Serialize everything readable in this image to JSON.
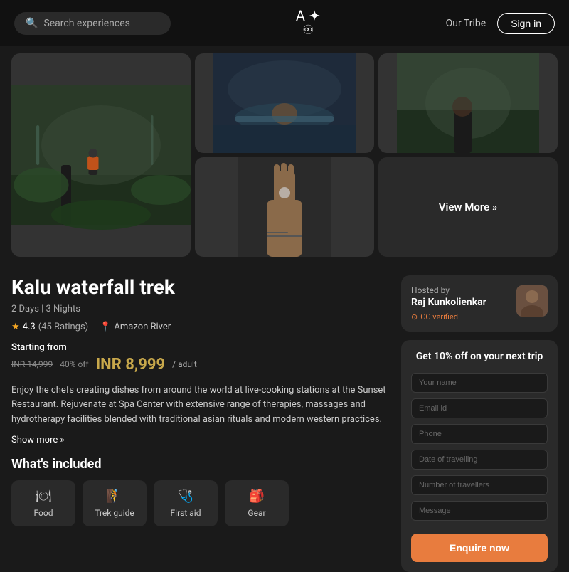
{
  "header": {
    "search_placeholder": "Search experiences",
    "logo_top": "A ✦",
    "logo_bottom": "♾",
    "our_tribe": "Our Tribe",
    "sign_in": "Sign in"
  },
  "gallery": {
    "view_more": "View More »"
  },
  "trip": {
    "title": "Kalu waterfall trek",
    "duration": "2 Days | 3 Nights",
    "rating": "4.3",
    "rating_count": "(45 Ratings)",
    "location": "Amazon River",
    "starting_from_label": "Starting from",
    "original_price": "INR 14,999",
    "discount": "40% off",
    "current_price": "INR 8,999",
    "per_adult": "/ adult",
    "description": "Enjoy the chefs creating dishes from around the world at live-cooking stations at the Sunset Restaurant. Rejuvenate at Spa Center with extensive range of therapies, massages and hydrotherapy facilities blended with traditional asian rituals and modern western practices.",
    "show_more": "Show more »"
  },
  "included": {
    "title": "What's included",
    "items": [
      {
        "icon": "🍽",
        "label": "Food"
      },
      {
        "icon": "🧗",
        "label": "Trek guide"
      },
      {
        "icon": "🩺",
        "label": "First aid"
      },
      {
        "icon": "🎒",
        "label": "Gear"
      }
    ]
  },
  "host": {
    "hosted_by": "Hosted by",
    "name": "Raj Kunkolienkar",
    "cc_verified": "CC verified"
  },
  "enquiry": {
    "title": "Get 10% off on your next trip",
    "fields": [
      {
        "placeholder": "Your name"
      },
      {
        "placeholder": "Email id"
      },
      {
        "placeholder": "Phone"
      },
      {
        "placeholder": "Date of travelling"
      },
      {
        "placeholder": "Number of travellers"
      },
      {
        "placeholder": "Message"
      }
    ],
    "button_label": "Enquire now"
  }
}
